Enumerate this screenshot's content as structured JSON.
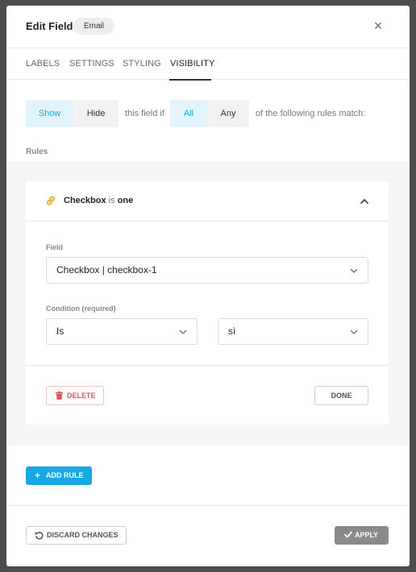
{
  "header": {
    "title": "Edit Field",
    "badge": "Email",
    "close_symbol": "×"
  },
  "tabs": [
    {
      "label": "LABELS",
      "active": false
    },
    {
      "label": "SETTINGS",
      "active": false
    },
    {
      "label": "STYLING",
      "active": false
    },
    {
      "label": "VISIBILITY",
      "active": true
    }
  ],
  "visibility": {
    "action_options": [
      {
        "label": "Show",
        "selected": true
      },
      {
        "label": "Hide",
        "selected": false
      }
    ],
    "text_middle": "this field if",
    "match_options": [
      {
        "label": "All",
        "selected": true
      },
      {
        "label": "Any",
        "selected": false
      }
    ],
    "text_end": "of the following rules match:"
  },
  "rules": {
    "section_label": "Rules",
    "items": [
      {
        "summary_field": "Checkbox",
        "summary_operator": "is",
        "summary_value": "one",
        "expanded": true,
        "field_label": "Field",
        "field_value": "Checkbox | checkbox-1",
        "condition_label": "Condition (required)",
        "condition_operator": "Is",
        "condition_value": "sì",
        "delete_label": "DELETE",
        "done_label": "DONE"
      }
    ],
    "add_rule_label": "ADD RULE"
  },
  "footer": {
    "discard_label": "DISCARD CHANGES",
    "apply_label": "APPLY"
  },
  "colors": {
    "accent": "#17a8e3",
    "accent_light": "#e1f4fb",
    "danger": "#e05656",
    "link_icon": "#f0b429",
    "apply_bg": "#8a8a8a",
    "overlay": "#4d4d4d"
  },
  "icons": {
    "close": "close-icon",
    "rule": "link-icon",
    "collapse": "chevron-up-icon",
    "dropdown": "chevron-down-icon",
    "delete": "trash-icon",
    "add": "plus-icon",
    "discard": "undo-icon",
    "apply": "check-icon"
  }
}
